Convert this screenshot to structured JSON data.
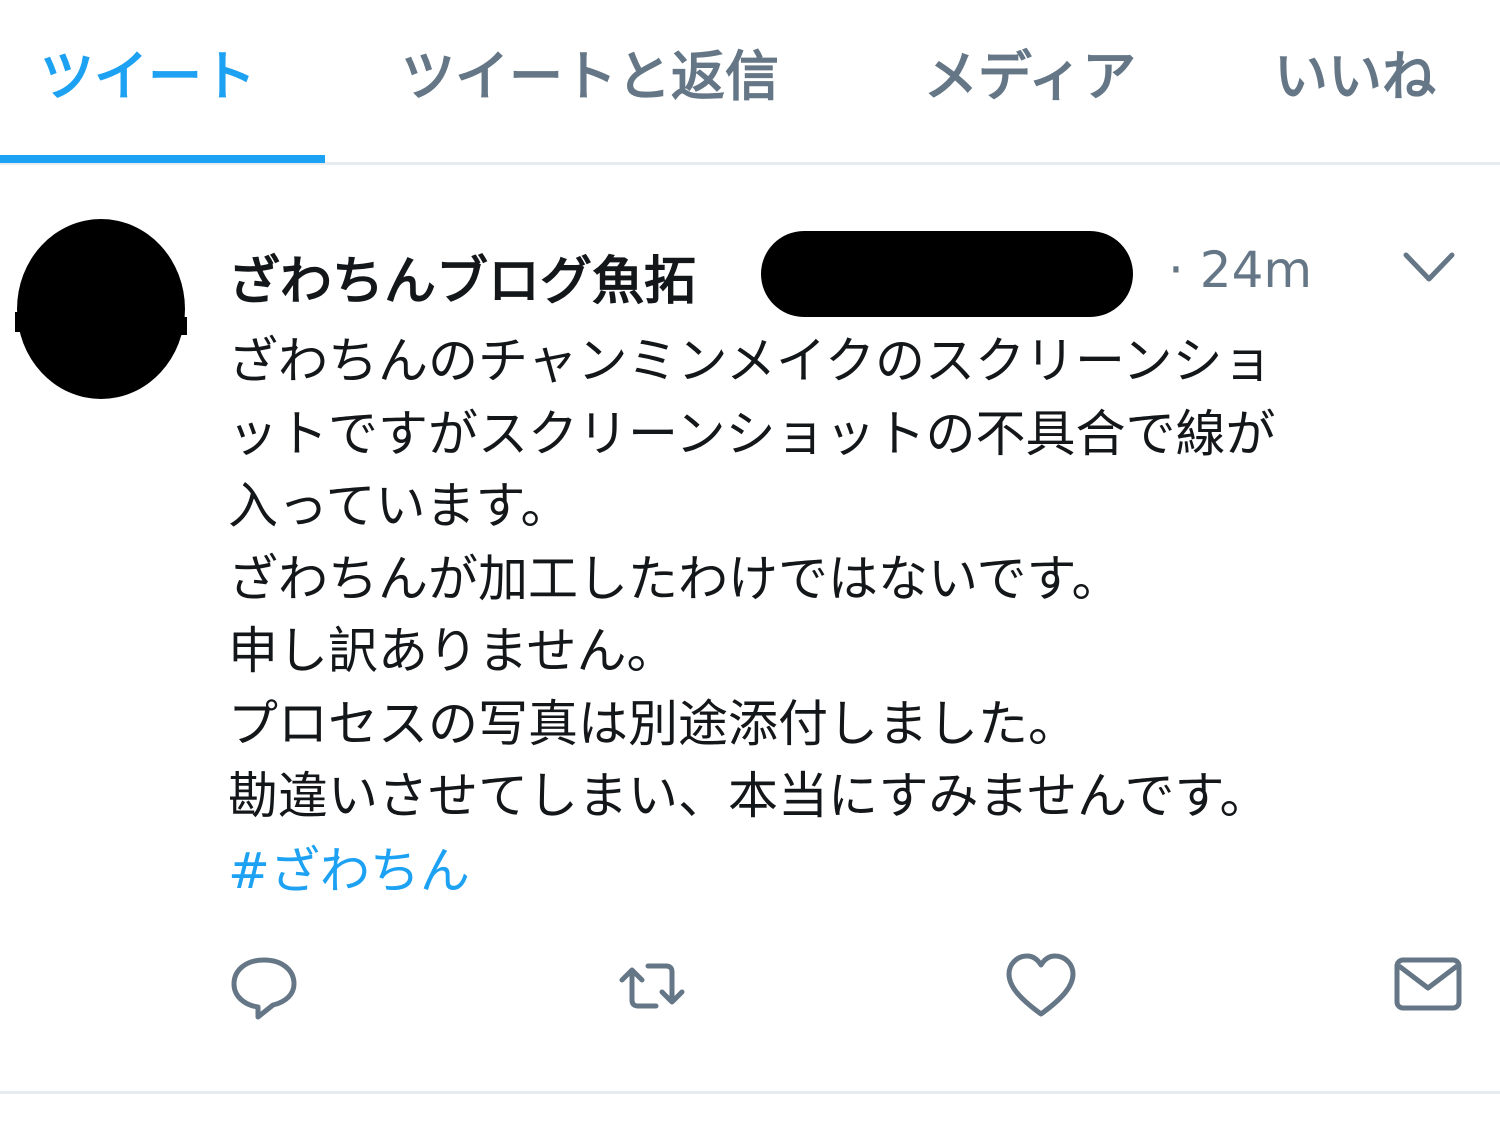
{
  "tabs": [
    {
      "label": "ツイート",
      "active": true
    },
    {
      "label": "ツイートと返信",
      "active": false
    },
    {
      "label": "メディア",
      "active": false
    },
    {
      "label": "いいね",
      "active": false
    }
  ],
  "tweet": {
    "display_name": "ざわちんブログ魚拓",
    "handle_redacted": true,
    "timestamp": "· 24m",
    "text_lines": [
      "ざわちんのチャンミンメイクのスクリーンショ",
      "ットですがスクリーンショットの不具合で線が",
      "入っています。",
      "ざわちんが加工したわけではないです。",
      "申し訳ありません。",
      "プロセスの写真は別途添付しました。",
      "勘違いさせてしまい、本当にすみませんです。"
    ],
    "hashtag": "#ざわちん",
    "icons": {
      "avatar": "avatar-silhouette",
      "menu": "chevron-down-icon",
      "reply": "reply-icon",
      "retweet": "retweet-icon",
      "like": "heart-icon",
      "dm": "envelope-icon"
    }
  },
  "colors": {
    "accent": "#1da1f2",
    "secondary_text": "#657786",
    "primary_text": "#14171a",
    "divider": "#e6ecf0"
  }
}
